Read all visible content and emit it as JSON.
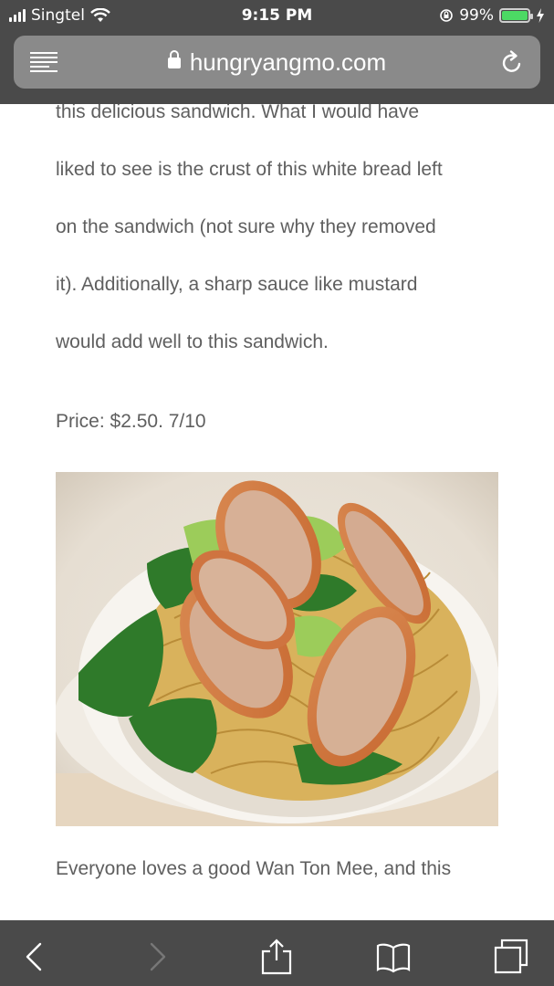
{
  "status_bar": {
    "carrier": "Singtel",
    "time": "9:15 PM",
    "battery_percent": "99%",
    "battery_level": 0.99,
    "icons": [
      "signal-bars-icon",
      "wifi-icon",
      "orientation-lock-icon",
      "battery-icon",
      "charging-bolt-icon"
    ]
  },
  "browser": {
    "domain": "hungryangmo.com",
    "icons": [
      "reader-menu-icon",
      "lock-icon",
      "reload-icon"
    ]
  },
  "article": {
    "lines": [
      "this delicious sandwich. What I would have",
      "liked to see is the crust of this white bread left",
      "on the sandwich (not sure why they removed",
      "it). Additionally, a sharp sauce like mustard",
      "would add well to this sandwich."
    ],
    "price": "Price: $2.50. 7/10",
    "next_line": "Everyone loves a good Wan Ton Mee, and this"
  },
  "toolbar": {
    "icons": [
      "back-icon",
      "forward-icon",
      "share-icon",
      "bookmarks-icon",
      "tabs-icon"
    ]
  },
  "colors": {
    "chrome": "#4a4a4a",
    "url_field": "#8a8a8a",
    "body_text": "#5f5f5f",
    "battery_fill": "#4cd964"
  }
}
